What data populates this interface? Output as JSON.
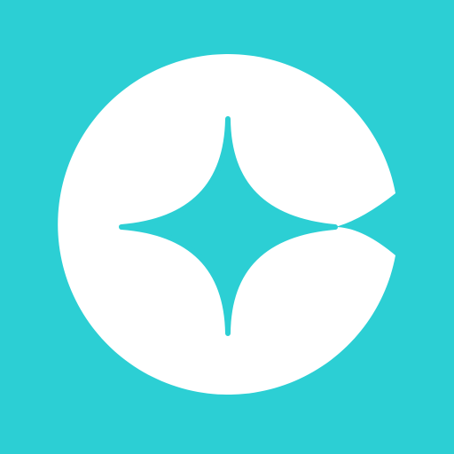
{
  "app_icon": {
    "icon": "sparkle-c-logo-icon",
    "colors": {
      "background": "#2ccfd4",
      "mark": "#ffffff",
      "sparkle": "#2ccfd4"
    }
  }
}
